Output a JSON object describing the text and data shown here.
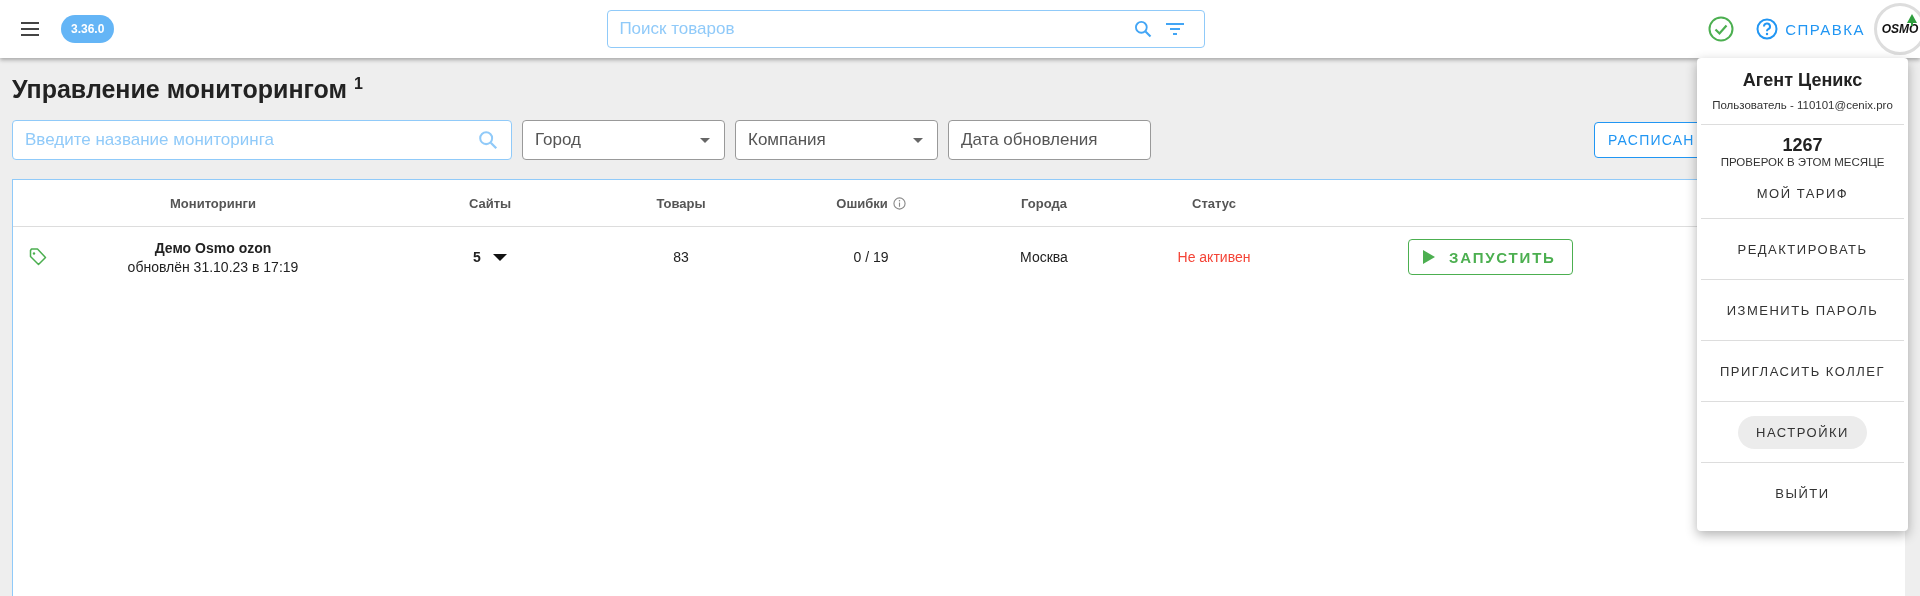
{
  "header": {
    "version": "3.36.0",
    "search": {
      "placeholder": "Поиск товаров"
    },
    "status_ok": true,
    "help": "СПРАВКА",
    "avatar_text": "OSMO"
  },
  "page": {
    "title": "Управление мониторингом",
    "title_note": "1"
  },
  "filters": {
    "search": {
      "placeholder": "Введите название мониторинга"
    },
    "city": {
      "placeholder": "Город"
    },
    "company": {
      "placeholder": "Компания"
    },
    "date": {
      "placeholder": "Дата обновления"
    },
    "schedule_button": "РАСПИСАН"
  },
  "table": {
    "columns": [
      {
        "label": "Мониторинги",
        "info": false
      },
      {
        "label": "Сайты",
        "info": false
      },
      {
        "label": "Товары",
        "info": false
      },
      {
        "label": "Ошибки",
        "info": true
      },
      {
        "label": "Города",
        "info": false
      },
      {
        "label": "Статус",
        "info": false
      }
    ],
    "rows": [
      {
        "name": "Демо Osmo ozon",
        "updated": "обновлён 31.10.23 в 17:19",
        "sites": "5",
        "goods": "83",
        "errors": "0 / 19",
        "city": "Москва",
        "status": "Не активен",
        "active": false,
        "action": "ЗАПУСТИТЬ"
      }
    ]
  },
  "user_menu": {
    "name": "Агент Ценикс",
    "subtitle": "Пользователь - 110101@cenix.pro",
    "count": "1267",
    "count_label": "ПРОВЕРОК В ЭТОМ МЕСЯЦЕ",
    "items": [
      {
        "label": "МОЙ ТАРИФ",
        "selected": false
      },
      {
        "label": "РЕДАКТИРОВАТЬ",
        "selected": false
      },
      {
        "label": "ИЗМЕНИТЬ ПАРОЛЬ",
        "selected": false
      },
      {
        "label": "ПРИГЛАСИТЬ КОЛЛЕГ",
        "selected": false
      },
      {
        "label": "НАСТРОЙКИ",
        "selected": true
      },
      {
        "label": "ВЫЙТИ",
        "selected": false
      }
    ]
  }
}
